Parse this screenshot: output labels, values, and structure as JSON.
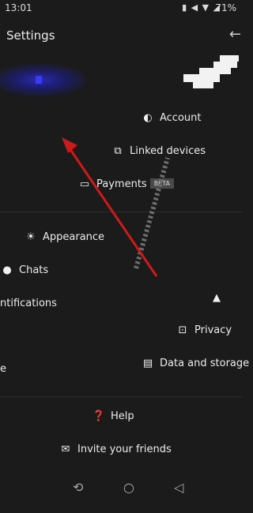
{
  "status_bar": {
    "time": "13:01",
    "icons": "▮ ◀ ▼ ◢",
    "battery": "71%"
  },
  "header": {
    "title": "Settings",
    "back_icon": "back-arrow-icon"
  },
  "items": {
    "account": "Account",
    "linked_devices": "Linked devices",
    "payments": "Payments",
    "payments_badge": "BETA",
    "appearance": "Appearance",
    "chats": "Chats",
    "notifications": "ntifications",
    "privacy": "Privacy",
    "data_storage": "Data and storage",
    "stories": "e",
    "help": "Help",
    "invite": "Invite your friends"
  },
  "navigation": {
    "recent": "⟲",
    "home": "○",
    "back": "◁"
  },
  "colors": {
    "background": "#1b1b1b",
    "accent": "#cc1a1a",
    "avatar": "#2a2ab0"
  }
}
